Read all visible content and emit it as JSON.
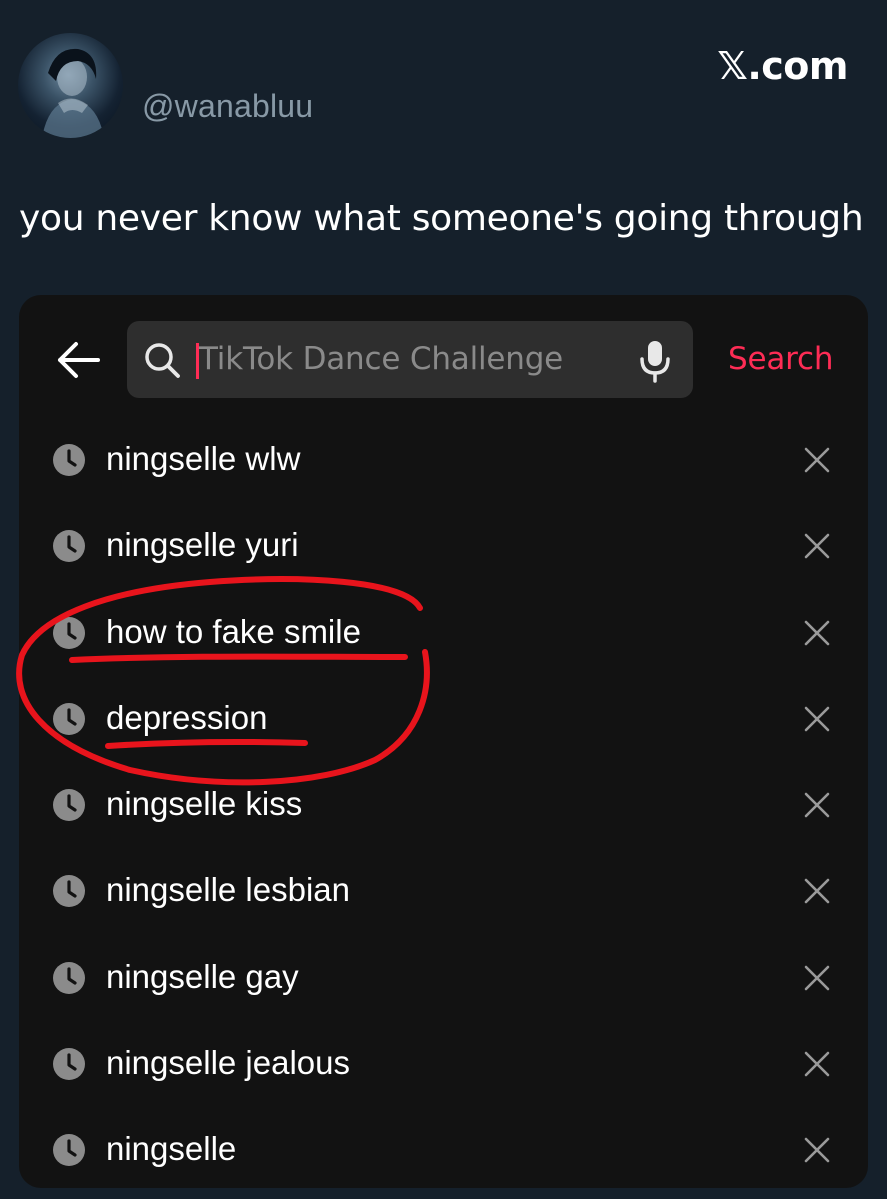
{
  "tweet": {
    "handle": "@wanabluu",
    "brand": "𝕏.com",
    "text": "you never know what someone's going through"
  },
  "tiktok": {
    "search": {
      "placeholder": "TikTok Dance Challenge",
      "search_label": "Search"
    },
    "history": [
      "ningselle wlw",
      "ningselle yuri",
      "how to fake smile",
      "depression",
      "ningselle kiss",
      "ningselle lesbian",
      "ningselle gay",
      "ningselle jealous",
      "ningselle"
    ]
  },
  "colors": {
    "background": "#15202b",
    "card": "#121212",
    "accent": "#fe2c55",
    "annotation": "#e8141c"
  },
  "icons": [
    "back-arrow-icon",
    "search-icon",
    "microphone-icon",
    "clock-icon",
    "close-icon"
  ]
}
